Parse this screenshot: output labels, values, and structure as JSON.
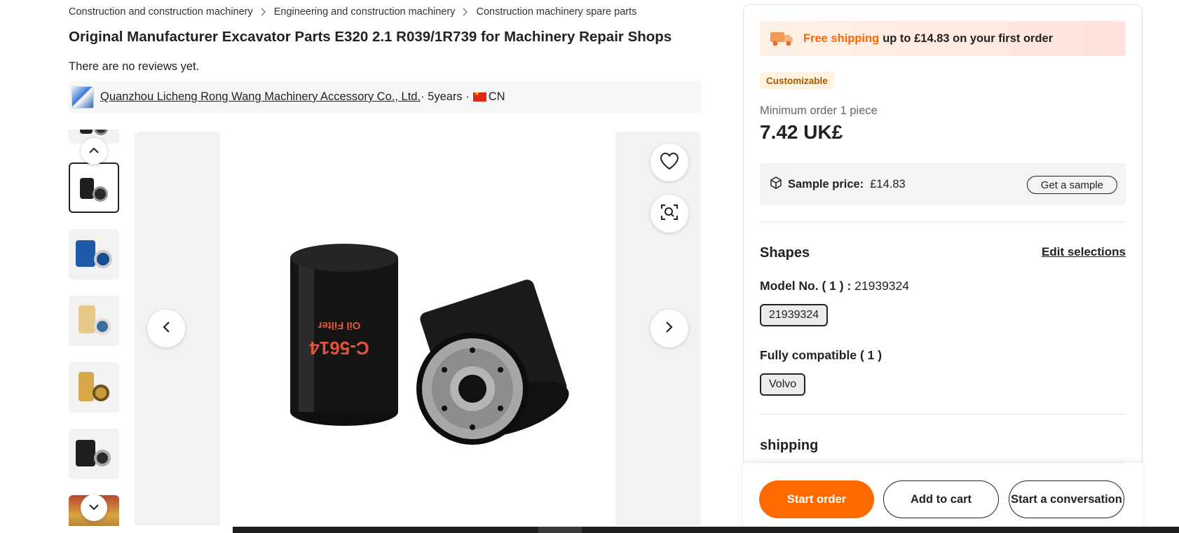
{
  "breadcrumb": [
    "Construction and construction machinery",
    "Engineering and construction machinery",
    "Construction machinery spare parts"
  ],
  "product": {
    "title": "Original Manufacturer Excavator Parts E320 2.1 R039/1R739 for Machinery Repair Shops",
    "reviews": "There are no reviews yet.",
    "image_label": "C-5614",
    "image_sublabel": "Oil Filter"
  },
  "supplier": {
    "name": "Quanzhou Licheng Rong Wang Machinery Accessory Co., Ltd.",
    "years": " · 5years · ",
    "country": "CN"
  },
  "gallery": {
    "icons": [
      "chevron-up-icon",
      "chevron-down-icon",
      "chevron-left-icon",
      "chevron-right-icon",
      "heart-icon",
      "image-search-icon"
    ]
  },
  "panel": {
    "promo_highlight": "Free shipping",
    "promo_rest": "up to £14.83 on your first order",
    "badge": "Customizable",
    "min_order": "Minimum order 1 piece",
    "price": "7.42 UK£",
    "sample_label": "Sample price:",
    "sample_value": "£14.83",
    "sample_button": "Get a sample",
    "shapes_heading": "Shapes",
    "edit_link": "Edit selections",
    "model_label": "Model No. ( 1 ) : ",
    "model_value": "21939324",
    "model_chip": "21939324",
    "compat_label": "Fully compatible ( 1 )",
    "compat_chip": "Volvo",
    "shipping_heading": "shipping"
  },
  "actions": {
    "start_order": "Start order",
    "add_to_cart": "Add to cart",
    "conversation": "Start a conversation"
  },
  "colors": {
    "accent": "#ff6a00",
    "promo_text": "#ff6600"
  }
}
